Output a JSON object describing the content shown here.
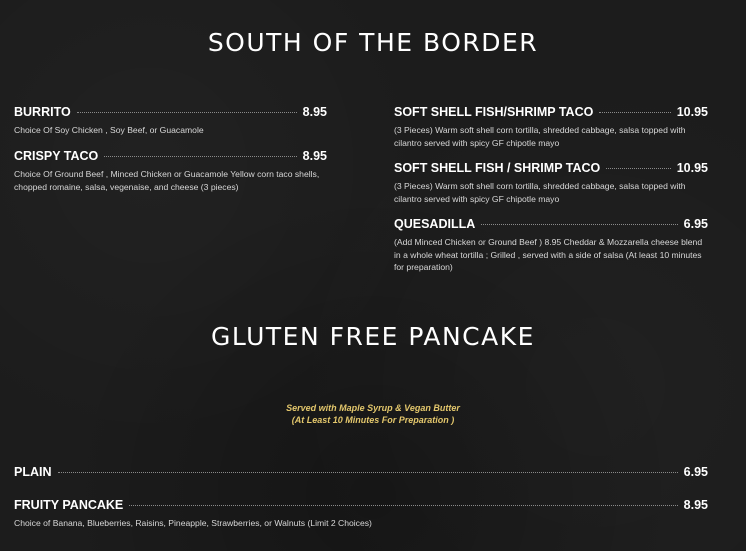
{
  "sections": [
    {
      "title": "SOUTH OF THE BORDER",
      "items": [
        {
          "name": "BURRITO",
          "price": "8.95",
          "desc": "Choice Of Soy Chicken , Soy Beef, or Guacamole"
        },
        {
          "name": "CRISPY TACO",
          "price": "8.95",
          "desc": "Choice Of Ground Beef , Minced Chicken or Guacamole Yellow corn taco shells, chopped romaine, salsa, vegenaise, and cheese (3 pieces)"
        },
        {
          "name": "SOFT SHELL FISH/SHRIMP TACO",
          "price": "10.95",
          "desc": "(3 Pieces) Warm soft shell corn tortilla, shredded cabbage, salsa topped with cilantro served with spicy GF chipotle mayo"
        },
        {
          "name": "SOFT SHELL FISH / SHRIMP TACO",
          "price": "10.95",
          "desc": "(3 Pieces) Warm soft shell corn tortilla, shredded cabbage, salsa topped with cilantro served with spicy GF chipotle mayo"
        },
        {
          "name": "QUESADILLA",
          "price": "6.95",
          "desc": "(Add Minced Chicken or Ground Beef ) 8.95 Cheddar & Mozzarella cheese blend in a whole wheat tortilla ; Grilled , served with a side of salsa (At least 10 minutes for preparation)"
        }
      ]
    },
    {
      "title": "GLUTEN FREE PANCAKE",
      "subtitle_line1": "Served with Maple Syrup & Vegan Butter",
      "subtitle_line2": "(At Least 10 Minutes For Preparation )",
      "items": [
        {
          "name": "PLAIN",
          "price": "6.95",
          "desc": ""
        },
        {
          "name": "FRUITY PANCAKE",
          "price": "8.95",
          "desc": "Choice of Banana, Blueberries, Raisins, Pineapple, Strawberries, or Walnuts (Limit 2 Choices)"
        }
      ]
    }
  ]
}
